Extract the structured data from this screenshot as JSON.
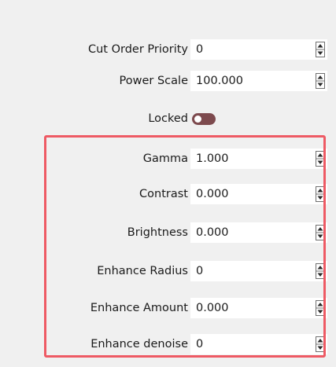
{
  "properties": {
    "cut_order_priority": {
      "label": "Cut Order Priority",
      "value": "0"
    },
    "power_scale": {
      "label": "Power Scale",
      "value": "100.000"
    },
    "locked": {
      "label": "Locked",
      "state": "on"
    },
    "gamma": {
      "label": "Gamma",
      "value": "1.000"
    },
    "contrast": {
      "label": "Contrast",
      "value": "0.000"
    },
    "brightness": {
      "label": "Brightness",
      "value": "0.000"
    },
    "enhance_radius": {
      "label": "Enhance Radius",
      "value": "0"
    },
    "enhance_amount": {
      "label": "Enhance Amount",
      "value": "0.000"
    },
    "enhance_denoise": {
      "label": "Enhance denoise",
      "value": "0"
    }
  },
  "colors": {
    "panel_background": "#f0f0f0",
    "field_background": "#ffffff",
    "toggle_on": "#7d4a4e",
    "highlight_border": "#ee5a64"
  },
  "icons": {
    "spinner": "spin-up-down-icon"
  }
}
